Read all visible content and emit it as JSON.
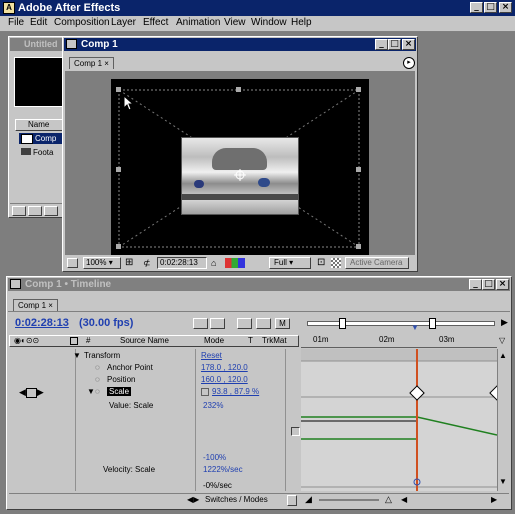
{
  "app": {
    "title": "Adobe After Effects"
  },
  "menu": [
    "File",
    "Edit",
    "Composition",
    "Layer",
    "Effect",
    "Animation",
    "View",
    "Window",
    "Help"
  ],
  "project": {
    "title": "Untitled",
    "col_name": "Name",
    "items": [
      "Comp",
      "Foota"
    ]
  },
  "comp_window": {
    "title": "Comp 1",
    "tab": "Comp 1",
    "zoom": "100%",
    "timecode": "0:02:28:13",
    "resolution": "Full",
    "camera": "Active Camera"
  },
  "timeline": {
    "title": "Comp 1 • Timeline",
    "tab": "Comp 1",
    "timecode": "0:02:28:13",
    "fps": "(30.00 fps)",
    "col_source": "Source Name",
    "col_mode": "Mode",
    "col_t": "T",
    "col_trkmat": "TrkMat",
    "ruler": [
      "01m",
      "02m",
      "03m"
    ],
    "props": {
      "transform": "Transform",
      "anchor": "Anchor Point",
      "position": "Position",
      "scale": "Scale",
      "value_scale": "Value: Scale",
      "velocity_scale": "Velocity: Scale"
    },
    "values": {
      "reset": "Reset",
      "anchor": "178.0 , 120.0",
      "position": "160.0 , 120.0",
      "scale": "93.8 , 87.9 %",
      "value_scale": "232%",
      "minus100": "-100%",
      "velocity": "1222%/sec",
      "zero_sec": "-0%/sec"
    },
    "switches": "Switches / Modes"
  },
  "colors": {
    "title_active": "#0a246a",
    "workspace": "#7e7e7e",
    "panel": "#c6c6c6",
    "value_blue": "#1f3fb0"
  }
}
